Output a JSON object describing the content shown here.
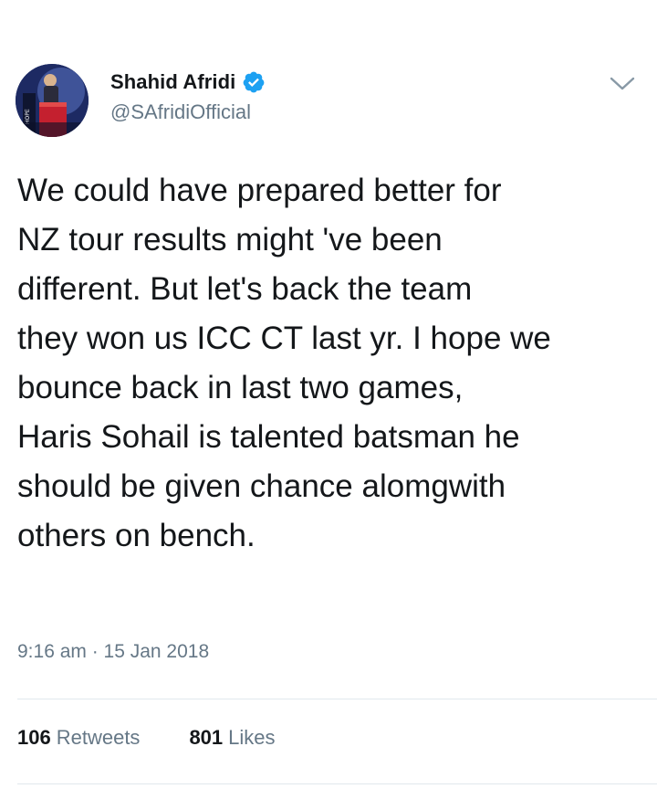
{
  "tweet": {
    "author": {
      "display_name": "Shahid Afridi",
      "handle": "@SAfridiOfficial",
      "verified": true,
      "avatar_icon": "profile-photo",
      "avatar_text": "HOPE"
    },
    "text_lines": [
      "We could have prepared better for",
      "NZ tour results might 've been",
      "different. But let's back the team",
      "they won us ICC CT last yr. I hope we",
      "bounce back in last two games,",
      "Haris Sohail is talented batsman he",
      "should be given chance alomgwith",
      "others on bench."
    ],
    "timestamp": "9:16 am · 15 Jan 2018",
    "stats": {
      "retweets_count": "106",
      "retweets_label": "Retweets",
      "likes_count": "801",
      "likes_label": "Likes"
    }
  },
  "colors": {
    "text_primary": "#14171a",
    "text_secondary": "#657786",
    "verified_blue": "#1da1f2",
    "divider": "#e1e8ed"
  },
  "icons": {
    "verified": "verified-badge-icon",
    "menu": "chevron-down-icon"
  }
}
